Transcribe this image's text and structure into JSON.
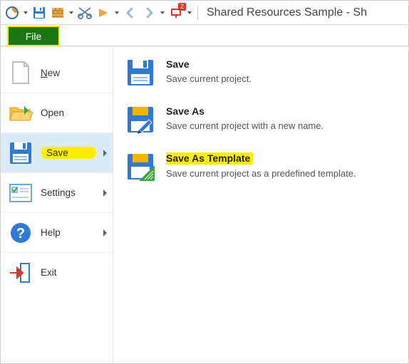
{
  "toolbar": {
    "notification_badge": "2",
    "title": "Shared Resources Sample - Sh"
  },
  "tabs": {
    "file_label": "File"
  },
  "menu": {
    "new": {
      "prefix": "N",
      "rest": "ew"
    },
    "open_label": "Open",
    "save_label": "Save",
    "settings_label": "Settings",
    "help_label": "Help",
    "exit_label": "Exit"
  },
  "detail": {
    "save": {
      "title": "Save",
      "desc": "Save current project."
    },
    "save_as": {
      "title": "Save As",
      "desc": "Save current project with a new name."
    },
    "save_as_template": {
      "title": "Save As Template",
      "desc": "Save current project as a predefined template."
    }
  }
}
